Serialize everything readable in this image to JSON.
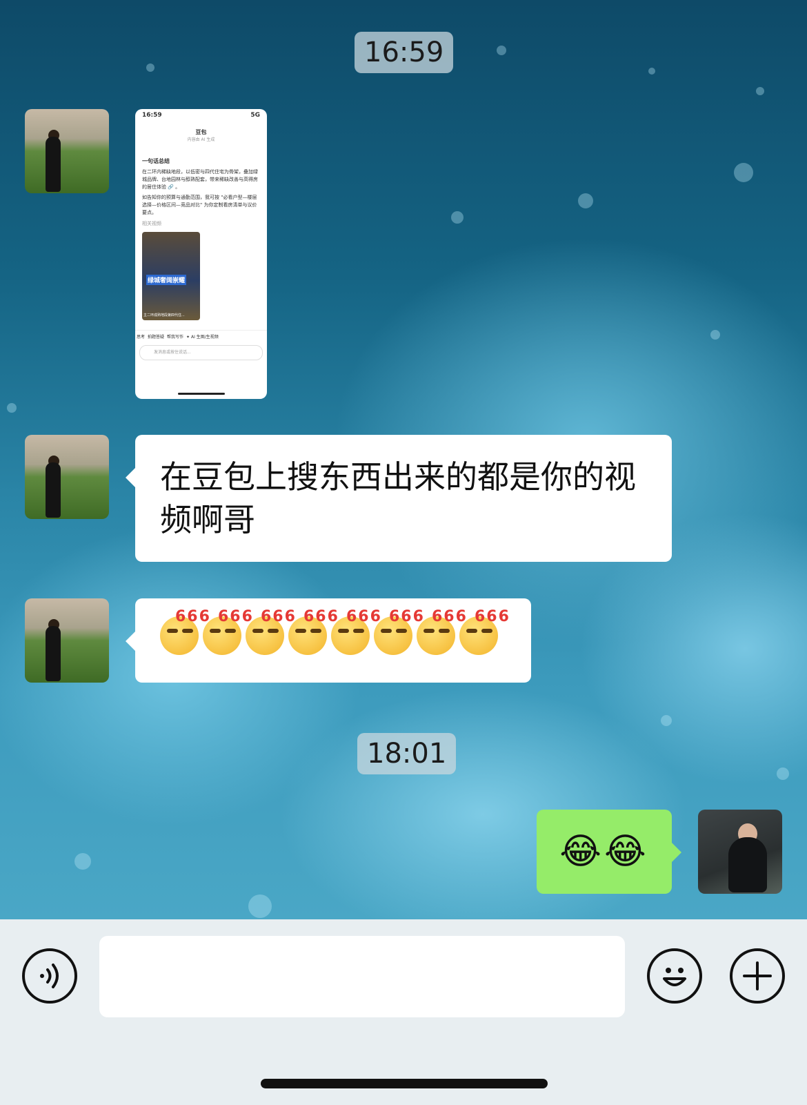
{
  "timestamps": [
    "16:59",
    "18:01"
  ],
  "messages": {
    "m2_text": "在豆包上搜东西出来的都是你的视频啊哥",
    "m3_emoji_tag": "666",
    "m3_emoji_count": 8,
    "m4_emoji": "😂😂"
  },
  "screenshot": {
    "time": "16:59",
    "signal": "5G",
    "app_title": "豆包",
    "app_subtitle": "内容由 AI 生成",
    "section_title": "一句话总结",
    "para1": "在二环内稀缺地段，以低密与四代住宅为骨架，叠加绿城品牌、台地园林与醇熟配套，带来稀缺改善与高得房的居住体验 🔗 。",
    "para2": "如告知你的预算与通勤范围，我可按 \"必看户型—楼层选择—价格区间—竞品对比\" 为你定制看房清单与议价要点。",
    "related_label": "相关视频",
    "video_caption": "绿城奢阔崇耀",
    "video_subcaption": "主二环成熟地段第四代住...",
    "chips": [
      "思考",
      "拍题答疑",
      "帮我写作",
      "✦ AI 生图/生视频"
    ],
    "input_placeholder": "发消息或按住说话..."
  },
  "bottom_bar": {
    "voice_icon": "voice-wave-icon",
    "emoji_icon": "smiley-icon",
    "plus_icon": "plus-icon",
    "input_value": ""
  }
}
